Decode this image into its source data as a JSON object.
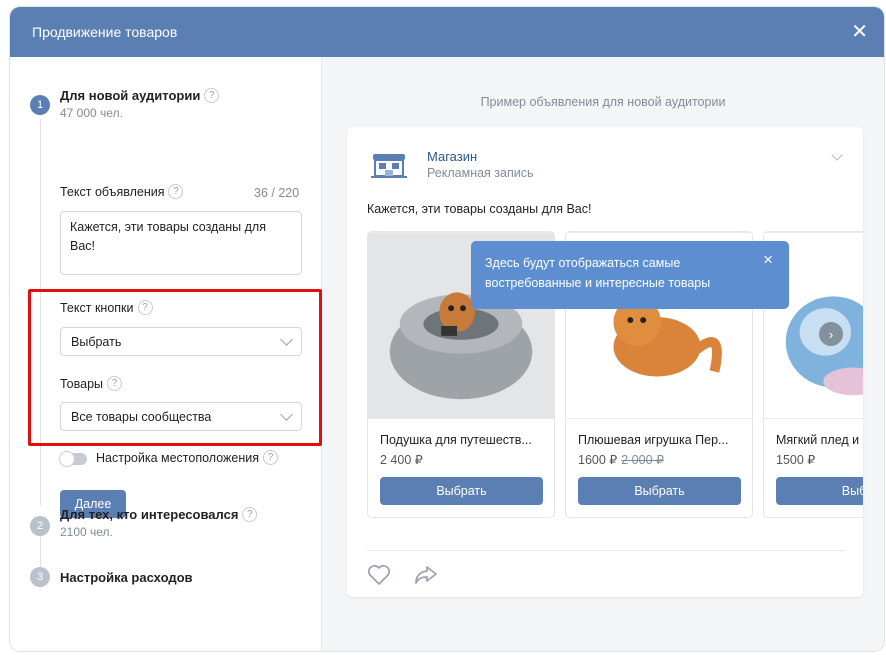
{
  "modal": {
    "title": "Продвижение товаров"
  },
  "steps": [
    {
      "number": "1",
      "title": "Для новой аудитории",
      "subtitle": "47 000 чел."
    },
    {
      "number": "2",
      "title": "Для тех, кто интересовался",
      "subtitle": "2100 чел."
    },
    {
      "number": "3",
      "title": "Настройка расходов"
    }
  ],
  "form": {
    "ad_text_label": "Текст объявления",
    "ad_text_counter": "36 / 220",
    "ad_text_value": "Кажется, эти товары созданы для Вас!",
    "button_text_label": "Текст кнопки",
    "button_text_value": "Выбрать",
    "products_label": "Товары",
    "products_value": "Все товары сообщества",
    "location_label": "Настройка местоположения",
    "next_button": "Далее",
    "help_glyph": "?"
  },
  "preview": {
    "caption": "Пример объявления для новой аудитории",
    "shop_name": "Магазин",
    "shop_sub": "Рекламная запись",
    "post_text": "Кажется, эти товары созданы для Вас!",
    "tooltip": "Здесь будут отображаться самые востребованные и интересные товары",
    "tooltip_close": "×",
    "cards": [
      {
        "title": "Подушка для путешеств...",
        "price": "2 400 ₽",
        "old_price": "",
        "button": "Выбрать"
      },
      {
        "title": "Плюшевая игрушка Пер...",
        "price": "1600 ₽",
        "old_price": "2 000 ₽",
        "button": "Выбрать"
      },
      {
        "title": "Мягкий плед и",
        "price": "1500 ₽",
        "old_price": "",
        "button": "Выбр"
      }
    ]
  },
  "colors": {
    "accent": "#5b7fb3",
    "tooltip": "#5c8ed0",
    "highlight": "#e01010"
  }
}
